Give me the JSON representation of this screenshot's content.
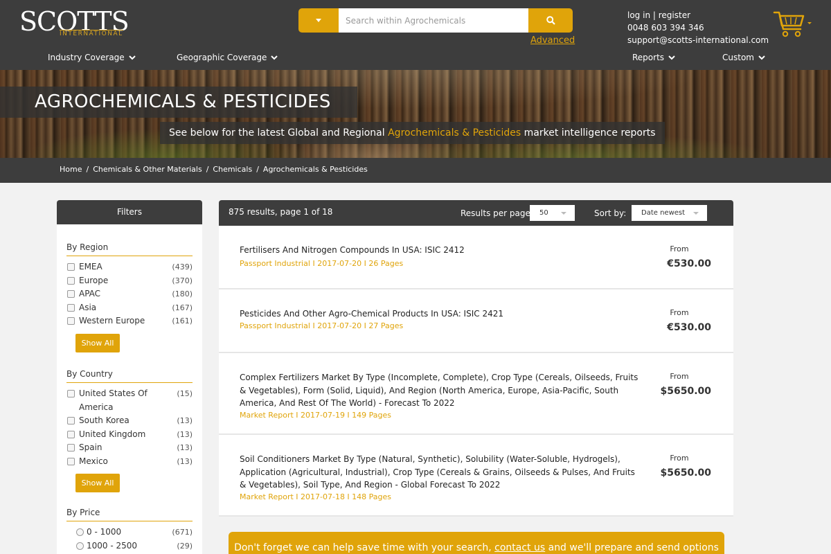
{
  "logo": {
    "main": "SCOTTS",
    "sub": "INTERNATIONAL"
  },
  "search": {
    "placeholder": "Search within Agrochemicals",
    "advanced_label": "Advanced"
  },
  "user": {
    "login": "log in",
    "separator": "|",
    "register": "register",
    "phone": "0048 603 394 346",
    "email": "support@scotts-international.com"
  },
  "nav": {
    "industry": "Industry Coverage",
    "geographic": "Geographic Coverage",
    "reports": "Reports",
    "custom": "Custom"
  },
  "banner": {
    "title": "AGROCHEMICALS & PESTICIDES",
    "sub_before": "See below for the latest Global and Regional",
    "sub_highlight": "Agrochemicals & Pesticides",
    "sub_after": "market intelligence reports"
  },
  "breadcrumb": [
    "Home",
    "Chemicals & Other Materials",
    "Chemicals",
    "Agrochemicals & Pesticides"
  ],
  "filters": {
    "heading": "Filters",
    "show_all": "Show All",
    "region": {
      "title": "By Region",
      "items": [
        {
          "label": "EMEA",
          "count": "(439)"
        },
        {
          "label": "Europe",
          "count": "(370)"
        },
        {
          "label": "APAC",
          "count": "(180)"
        },
        {
          "label": "Asia",
          "count": "(167)"
        },
        {
          "label": "Western Europe",
          "count": "(161)"
        }
      ]
    },
    "country": {
      "title": "By Country",
      "items": [
        {
          "label": "United States Of America",
          "count": "(15)"
        },
        {
          "label": "South Korea",
          "count": "(13)"
        },
        {
          "label": "United Kingdom",
          "count": "(13)"
        },
        {
          "label": "Spain",
          "count": "(13)"
        },
        {
          "label": "Mexico",
          "count": "(13)"
        }
      ]
    },
    "price": {
      "title": "By Price",
      "items": [
        {
          "label": "0 - 1000",
          "count": "(671)"
        },
        {
          "label": "1000 - 2500",
          "count": "(29)"
        }
      ]
    }
  },
  "results": {
    "count_text": "875 results, page 1 of 18",
    "per_page_label": "Results per page",
    "per_page_value": "50",
    "sort_label": "Sort by:",
    "sort_value": "Date newest",
    "items": [
      {
        "title": "Fertilisers And Nitrogen Compounds In USA: ISIC 2412",
        "meta": "Passport Industrial I 2017-07-20 I 26 Pages",
        "from": "From",
        "price": "€530.00"
      },
      {
        "title": "Pesticides And Other Agro-Chemical Products In USA: ISIC 2421",
        "meta": "Passport Industrial I 2017-07-20 I 27 Pages",
        "from": "From",
        "price": "€530.00"
      },
      {
        "title": "Complex Fertilizers Market By Type (Incomplete, Complete), Crop Type (Cereals, Oilseeds, Fruits & Vegetables), Form (Solid, Liquid), And Region (North America, Europe, Asia-Pacific, South America, And Rest Of The World) - Forecast To 2022",
        "meta": "Market Report I 2017-07-19 I 149 Pages",
        "from": "From",
        "price": "$5650.00"
      },
      {
        "title": "Soil Conditioners Market By Type (Natural, Synthetic), Solubility (Water-Soluble, Hydrogels), Application (Agricultural, Industrial), Crop Type (Cereals & Grains, Oilseeds & Pulses, And Fruits & Vegetables), Soil Type, And Region - Global Forecast To 2022",
        "meta": "Market Report I 2017-07-18 I 148 Pages",
        "from": "From",
        "price": "$5650.00"
      }
    ]
  },
  "cta": {
    "before": "Don't forget we can help save time with your search,",
    "link": "contact us",
    "after": "and we'll prepare and send options"
  },
  "colors": {
    "accent": "#e0a40a",
    "dark": "#3d3d3d"
  }
}
